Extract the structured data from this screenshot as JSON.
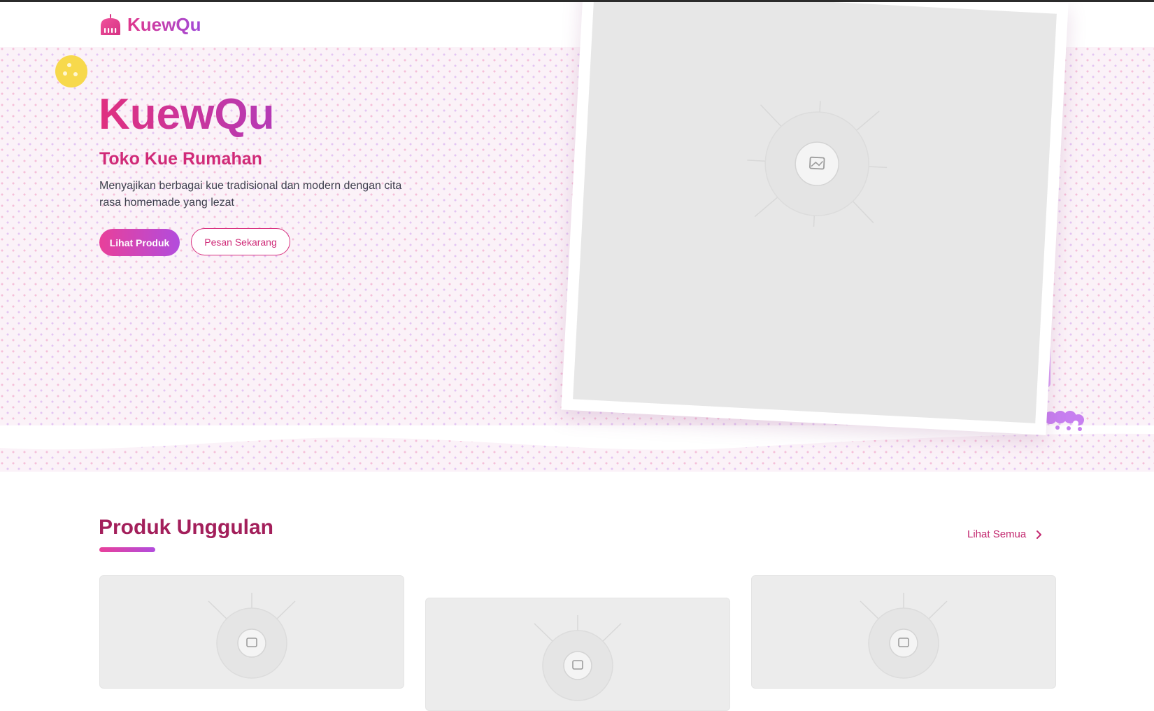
{
  "brand": {
    "name": "KuewQu",
    "icon": "cake-icon",
    "colors": {
      "pink": "#e0368b",
      "purple": "#a24ad8"
    }
  },
  "hero": {
    "title": "KuewQu",
    "subtitle": "Toko Kue Rumahan",
    "description": "Menyajikan berbagai kue tradisional dan modern dengan cita rasa homemade yang lezat",
    "primary_button": "Lihat Produk",
    "secondary_button": "Pesan Sekarang",
    "image_icon": "image-placeholder-icon",
    "decoration_icon": "cookie-icon"
  },
  "featured": {
    "title": "Produk Unggulan",
    "see_all": "Lihat Semua",
    "see_all_icon": "chevron-right-icon",
    "products": [
      {
        "image_icon": "image-placeholder-icon"
      },
      {
        "image_icon": "image-placeholder-icon"
      },
      {
        "image_icon": "image-placeholder-icon"
      }
    ]
  }
}
